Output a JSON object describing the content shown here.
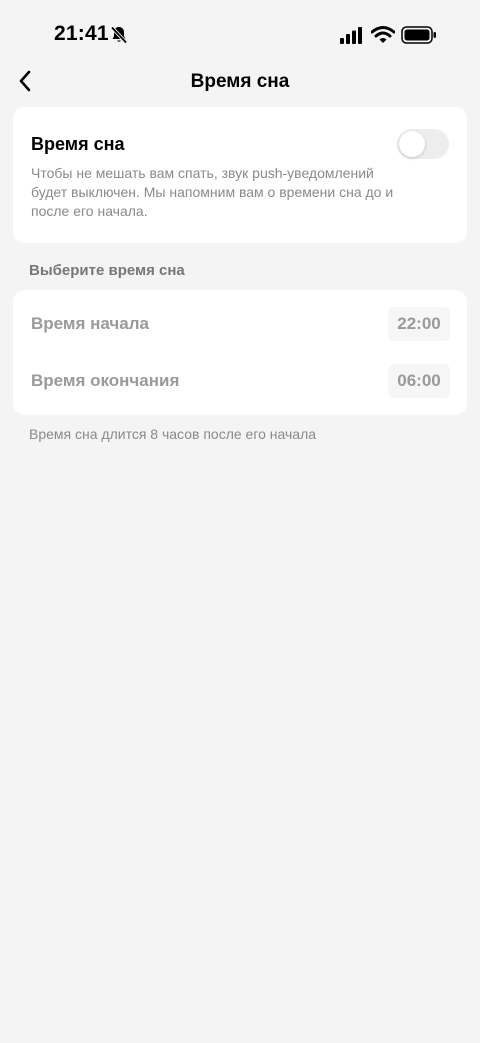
{
  "status_bar": {
    "time": "21:41",
    "icons": [
      "bell-slash-icon",
      "signal-icon",
      "wifi-icon",
      "battery-icon"
    ]
  },
  "nav": {
    "title": "Время сна",
    "back_icon": "chevron-left-icon"
  },
  "sleep_card": {
    "title": "Время сна",
    "toggle_on": false,
    "description": "Чтобы не мешать вам спать, звук push-уведомлений будет выключен. Мы напомним вам о времени сна до и после его начала."
  },
  "time_section": {
    "label": "Выберите время сна",
    "start": {
      "label": "Время начала",
      "value": "22:00"
    },
    "end": {
      "label": "Время окончания",
      "value": "06:00"
    },
    "note": "Время сна длится 8 часов после его начала"
  },
  "colors": {
    "background": "#f4f4f4",
    "card": "#ffffff",
    "muted_text": "#8a8a8a",
    "disabled_text": "#9a9a9a",
    "toggle_off": "#ededed"
  }
}
